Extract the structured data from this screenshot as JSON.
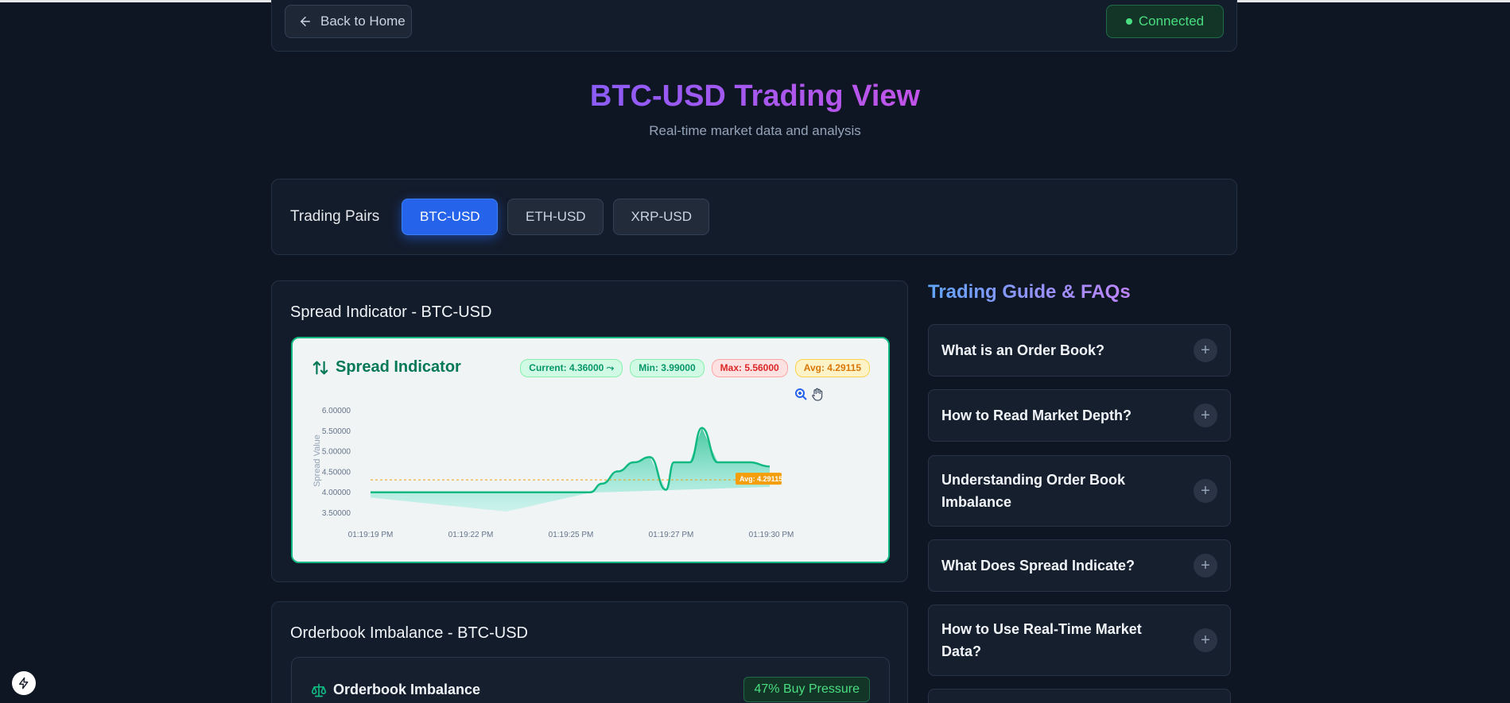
{
  "header": {
    "back_label": "Back to Home",
    "status_label": "Connected"
  },
  "page": {
    "title": "BTC-USD Trading View",
    "subtitle": "Real-time market data and analysis"
  },
  "pairs": {
    "label": "Trading Pairs",
    "items": [
      "BTC-USD",
      "ETH-USD",
      "XRP-USD"
    ],
    "active": "BTC-USD"
  },
  "spread_card": {
    "title": "Spread Indicator - BTC-USD",
    "panel_title": "Spread Indicator",
    "current": "Current: 4.36000",
    "min": "Min: 3.99000",
    "max": "Max: 5.56000",
    "avg": "Avg: 4.29115",
    "avg_marker": "Avg: 4.29115"
  },
  "chart_data": {
    "type": "area",
    "ylabel": "Spread Value",
    "xlabel": "",
    "y_ticks": [
      "6.00000",
      "5.50000",
      "5.00000",
      "4.50000",
      "4.00000",
      "3.50000"
    ],
    "x_ticks": [
      "01:19:19 PM",
      "01:19:22 PM",
      "01:19:25 PM",
      "01:19:27 PM",
      "01:19:30 PM"
    ],
    "ylim": [
      3.5,
      6.0
    ],
    "average": 4.29115,
    "series": [
      {
        "x": [
          0,
          0.1,
          0.2,
          0.3,
          0.4,
          0.5,
          0.55,
          0.58,
          0.62,
          0.66,
          0.7,
          0.74,
          0.76,
          0.78,
          0.8,
          0.83,
          0.87,
          0.88,
          0.91,
          0.95,
          1.0
        ],
        "values": [
          3.99,
          3.99,
          3.99,
          3.99,
          3.99,
          3.99,
          3.99,
          4.2,
          4.5,
          4.72,
          4.85,
          4.05,
          4.72,
          4.72,
          4.72,
          5.56,
          4.72,
          4.72,
          4.72,
          4.72,
          4.62
        ]
      }
    ],
    "colors": {
      "line": "#10b981",
      "avg": "#f59e0b"
    }
  },
  "faq": {
    "title": "Trading Guide & FAQs",
    "items": [
      "What is an Order Book?",
      "How to Read Market Depth?",
      "Understanding Order Book Imbalance",
      "What Does Spread Indicate?",
      "How to Use Real-Time Market Data?"
    ]
  },
  "orderbook_card": {
    "title": "Orderbook Imbalance - BTC-USD",
    "panel_title": "Orderbook Imbalance",
    "pressure": "47% Buy Pressure"
  },
  "icons": {
    "back": "arrow-left-icon",
    "status": "status-dot-icon",
    "spread": "arrows-up-down-icon",
    "zoom": "zoom-in-icon",
    "pan": "hand-pan-icon",
    "balance": "scale-icon",
    "bolt": "lightning-bolt-icon",
    "plus": "plus-icon"
  }
}
